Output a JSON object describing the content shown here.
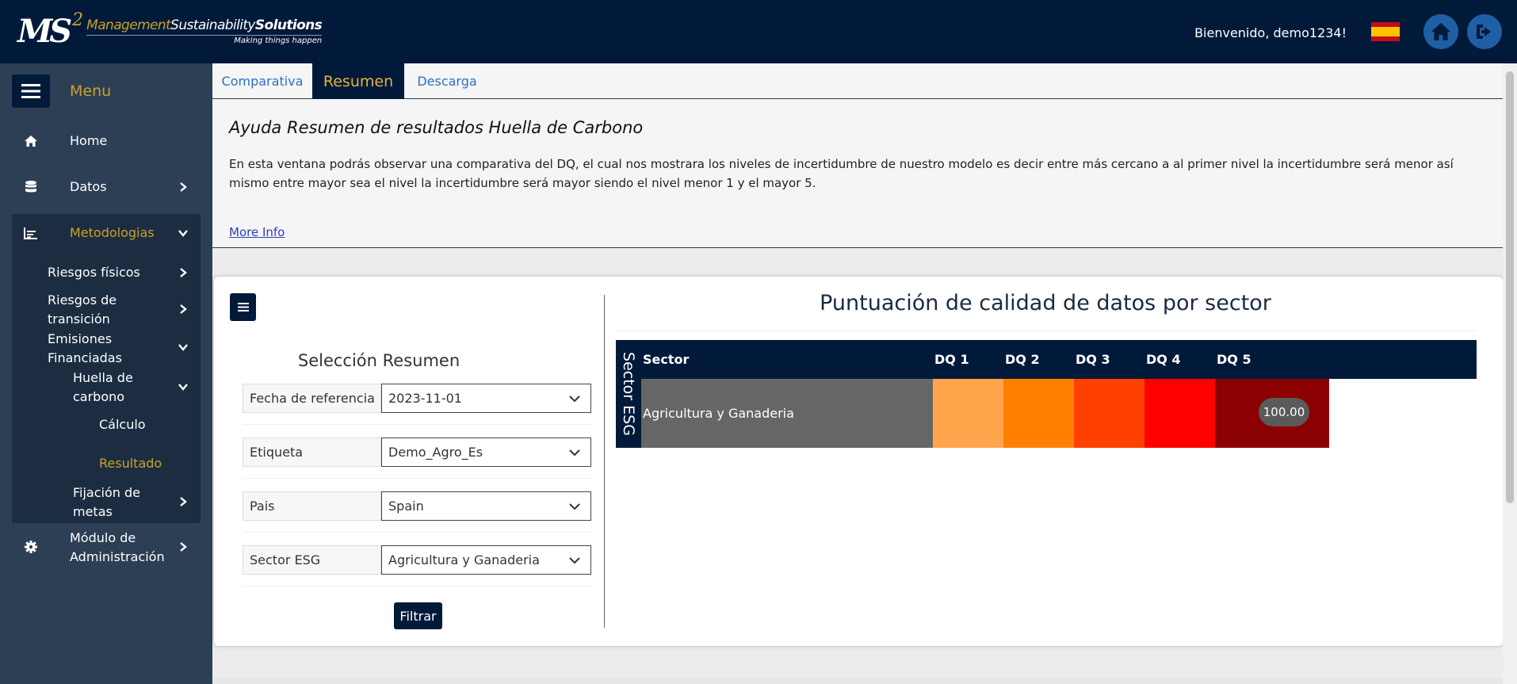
{
  "header": {
    "logo": {
      "ms": "MS",
      "sup": "2",
      "line1_a": "Management",
      "line1_b": "Sustainability",
      "line1_c": "Solutions",
      "tagline": "Making things happen"
    },
    "welcome": "Bienvenido, demo1234!",
    "icons": [
      "spain-flag-icon",
      "home-icon",
      "logout-icon"
    ]
  },
  "sidebar": {
    "menu_label": "Menu",
    "items": [
      {
        "label": "Home",
        "icon": "home-icon"
      },
      {
        "label": "Datos",
        "icon": "database-icon"
      },
      {
        "label": "Metodologias",
        "icon": "chart-icon"
      },
      {
        "label": "Riesgos físicos"
      },
      {
        "label": "Riesgos de transición"
      },
      {
        "label": "Emisiones Financiadas"
      },
      {
        "label": "Huella de carbono"
      },
      {
        "label": "Cálculo"
      },
      {
        "label": "Resultado"
      },
      {
        "label": "Fijación de metas"
      },
      {
        "label": "Módulo de Administración",
        "icon": "gear-icon"
      }
    ],
    "active_color": "#c9a227"
  },
  "tabs": [
    {
      "label": "Comparativa"
    },
    {
      "label": "Resumen",
      "active": true
    },
    {
      "label": "Descarga"
    }
  ],
  "help": {
    "title": "Ayuda Resumen de resultados Huella de Carbono",
    "text": "En esta ventana podrás observar una comparativa del DQ, el cual nos mostrara los niveles de incertidumbre de nuestro modelo es decir entre más cercano a al primer nivel la incertidumbre será menor así mismo entre mayor sea el nivel la incertidumbre será mayor siendo el nivel menor 1 y el mayor 5.",
    "link": "More Info"
  },
  "filters": {
    "title": "Selección Resumen",
    "rows": [
      {
        "label": "Fecha de referencia",
        "value": "2023-11-01"
      },
      {
        "label": "Etiqueta",
        "value": "Demo_Agro_Es"
      },
      {
        "label": "Pais",
        "value": "Spain"
      },
      {
        "label": "Sector ESG",
        "value": "Agricultura y Ganaderia"
      }
    ],
    "button": "Filtrar"
  },
  "chart_data": {
    "type": "heatmap",
    "title": "Puntuación de calidad de datos por sector",
    "ylabel": "Sector ESG",
    "header_sector": "Sector",
    "columns": [
      "DQ 1",
      "DQ 2",
      "DQ 3",
      "DQ 4",
      "DQ 5"
    ],
    "rows": [
      {
        "sector": "Agricultura y Ganaderia",
        "values": [
          null,
          null,
          null,
          null,
          100.0
        ],
        "value_labels": [
          "",
          "",
          "",
          "",
          "100.00"
        ]
      }
    ],
    "column_colors": [
      "#ffa64d",
      "#ff8000",
      "#ff4000",
      "#ff0000",
      "#8b0000"
    ],
    "sector_color": "#666666",
    "header_color": "#021a3a"
  }
}
